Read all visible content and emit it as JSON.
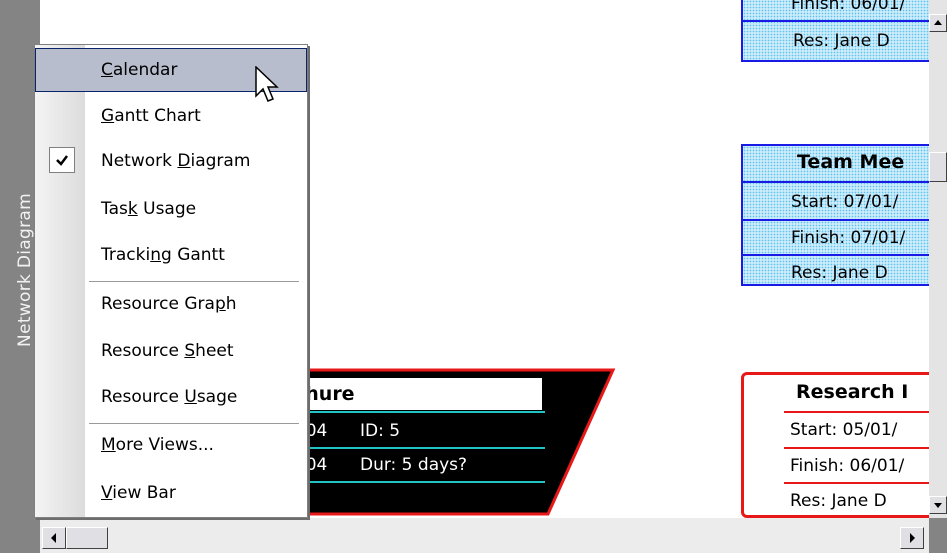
{
  "view_bar": {
    "label": "Network Diagram"
  },
  "nodes": {
    "top": {
      "finish_line": "Finish: 06/01/",
      "res_line": "Res:   Jane D"
    },
    "team_meeting": {
      "title": "Team Mee",
      "start": "Start:  07/01/",
      "finish": "Finish: 07/01/",
      "res": "Res:   Jane D"
    },
    "brochure": {
      "title": "chure",
      "row1_date": "/04",
      "row1_id": "ID:  5",
      "row2_date": "/04",
      "row2_dur": "Dur: 5 days?"
    },
    "research": {
      "title": "Research I",
      "start": "Start:  05/01/",
      "finish": "Finish: 06/01/",
      "res": "Res:   Jane D"
    }
  },
  "menu": {
    "items": [
      {
        "label": "Calendar",
        "mnemonic": "C",
        "highlighted": true,
        "checked": false
      },
      {
        "label": "Gantt Chart",
        "mnemonic": "G",
        "highlighted": false,
        "checked": false
      },
      {
        "label": "Network Diagram",
        "mnemonic": "D",
        "highlighted": false,
        "checked": true
      },
      {
        "label": "Task Usage",
        "mnemonic": "k",
        "highlighted": false,
        "checked": false
      },
      {
        "label": "Tracking Gantt",
        "mnemonic": "n",
        "highlighted": false,
        "checked": false
      },
      {
        "label": "Resource Graph",
        "mnemonic": "p",
        "highlighted": false,
        "checked": false
      },
      {
        "label": "Resource Sheet",
        "mnemonic": "S",
        "highlighted": false,
        "checked": false
      },
      {
        "label": "Resource Usage",
        "mnemonic": "U",
        "highlighted": false,
        "checked": false
      },
      {
        "label": "More Views...",
        "mnemonic": "M",
        "highlighted": false,
        "checked": false
      },
      {
        "label": "View Bar",
        "mnemonic": "V",
        "highlighted": false,
        "checked": false
      }
    ]
  },
  "colors": {
    "menu_highlight": "#b7bdcc",
    "node_blue_border": "#1a1ae6",
    "node_red_border": "#e81818",
    "brochure_bg": "#000000",
    "cyan_line": "#21c4c4"
  }
}
